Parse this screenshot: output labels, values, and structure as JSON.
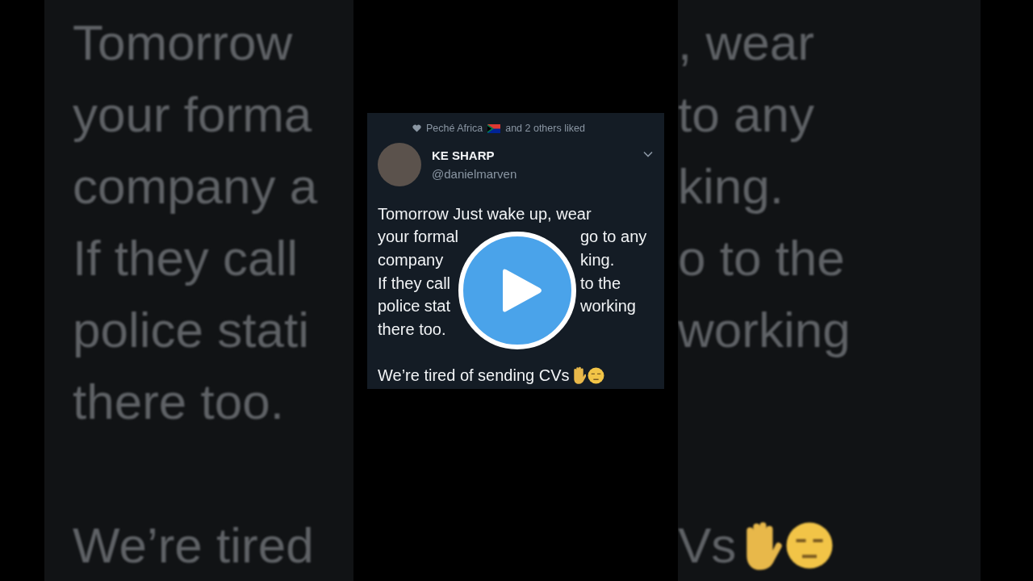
{
  "background": {
    "left_lines": [
      {
        "kind": "text",
        "text": "Tomorrow"
      },
      {
        "kind": "text",
        "text": "your forma"
      },
      {
        "kind": "text",
        "text": "company a"
      },
      {
        "kind": "text",
        "text": "If they call"
      },
      {
        "kind": "text",
        "text": "police stati"
      },
      {
        "kind": "text",
        "text": "there too."
      },
      {
        "kind": "blank"
      },
      {
        "kind": "text",
        "text": "We’re tired"
      }
    ],
    "right_lines": [
      {
        "kind": "text",
        "text": ", wear"
      },
      {
        "kind": "text",
        "text": "to any"
      },
      {
        "kind": "text",
        "text": "king."
      },
      {
        "kind": "text",
        "text": "o to the"
      },
      {
        "kind": "text",
        "text": "working"
      },
      {
        "kind": "blank"
      },
      {
        "kind": "blank"
      },
      {
        "kind": "text",
        "text": "Vs",
        "emoji": true
      }
    ]
  },
  "tweet": {
    "social_context": {
      "name": "Peché Africa",
      "rest": "and 2 others liked"
    },
    "author": {
      "name": "KE SHARP",
      "handle": "@danielmarven"
    },
    "lines": [
      {
        "kind": "text",
        "left": "Tomorrow Just wake up, wear"
      },
      {
        "kind": "text",
        "left": "your formal",
        "right": "go to any"
      },
      {
        "kind": "text",
        "left": "company",
        "right": "king."
      },
      {
        "kind": "text",
        "left": "If they call",
        "right": "to the"
      },
      {
        "kind": "text",
        "left": "police stat",
        "right": "working"
      },
      {
        "kind": "text",
        "left": "there too."
      },
      {
        "kind": "blank"
      },
      {
        "kind": "text",
        "left": "We’re tired of sending CVs",
        "emoji": true
      }
    ]
  }
}
